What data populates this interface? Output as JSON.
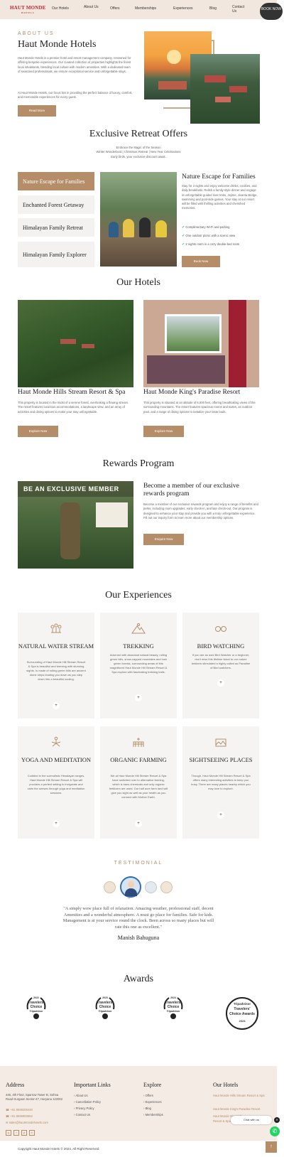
{
  "nav": {
    "logo": "HAUT MONDE",
    "logo_sub": "HOTELS",
    "links": [
      "Our Hotels",
      "About Us",
      "Offers",
      "Memberships",
      "Experiences",
      "Blog",
      "Contact Us"
    ],
    "book": "BOOK NOW"
  },
  "about": {
    "eyebrow": "ABOUT US",
    "title": "Haut Monde Hotels",
    "p1": "Haut Monde Hotels is a premier hotel and resort management company, renowned for offering bespoke experiences. Our curated collection of properties highlights the finest local inhabitants, blending local culture with modern amenities. With a dedicated team of seasoned professionals, we ensure exceptional service and unforgettable stays.",
    "p2": "At Haut Monde Hotels, our focus lies in providing the perfect balance of luxury, comfort, and memorable experiences for every guest.",
    "button": "Read More"
  },
  "offers": {
    "title": "Exclusive Retreat Offers",
    "sub1": "Embrace the Magic of the Season",
    "sub2": "Winter Wonderland | Christmas Retreat | New Year Celebrations",
    "sub3": "Early birds, your exclusive discount await.",
    "tabs": [
      "Nature Escape for Families",
      "Enchanted Forest Getaway",
      "Himalayan Family Retreat",
      "Himalayan Family Explorer"
    ],
    "detail_title": "Nature Escape for Families",
    "detail_text": "Stay for 3 nights and enjoy welcome drinks, cookies, and daily breakfasts. Relish a family-style dinner and engage in unforgettable guided river treks, Jejime, Jivanta Bridge, swimming and pool-side games. Your stay at our resort will be filled with thrilling activities and cherished memories.",
    "features": [
      "Complimentary Wi-Fi and parking",
      "One outdoor picnic with a scenic view",
      "2 nights room in a cozy double-bed room"
    ],
    "button": "Book Now"
  },
  "hotels": {
    "title": "Our Hotels",
    "items": [
      {
        "name": "Haut Monde Hills Stream Resort & Spa",
        "desc": "This property is located in the midst of a serene forest, overlooking a flowing stream. The resort features luxurious accommodations, a landscape view, and an array of activities and dining options to make your stay unforgettable.",
        "button": "Explore Now"
      },
      {
        "name": "Haut Monde King's Paradise Resort",
        "desc": "This property is situated at an altitude of 6,000 feet, offering breathtaking views of the surrounding mountains. The resort features spacious rooms and suites, an outdoor pool, and a range of dining options to tantalize your taste buds.",
        "button": "Explore Now"
      }
    ]
  },
  "rewards": {
    "title": "Rewards Program",
    "banner": "BE AN EXCLUSIVE MEMBER",
    "heading": "Become a member of our exclusive rewards program",
    "text": "Become a member of our exclusive rewards program and enjoy a range of benefits and perks, including room upgrades, early check-in, and late check-out. Our program is designed to enhance your stay and provide you with a truly unforgettable experience. Fill out our inquiry form to learn more about our membership options.",
    "button": "Enquire Now"
  },
  "experiences": {
    "title": "Our Experiences",
    "items": [
      {
        "title": "NATURAL WATER STREAM",
        "desc": "Surrounding of Haut Monde Hill Stream Resort & Spa is beautiful and teeming with stunning sights. Is made of rolling green hills are ancient stone steps leading you down as you step down into a beautiful cooling."
      },
      {
        "title": "TREKKING",
        "desc": "Adorned with abundant natural beauty, rolling green hills, snow-capped mountains and lush green forests, surrounding areas of this magnificent Haut Monde Hill Stream Resort & Spa explore with fascinating trekking trails."
      },
      {
        "title": "BIRD WATCHING",
        "desc": "If you are an avid Bird Watcher or a beginner, don't miss this lifetime ticket to our nature trekkers stimulated a highly called as Paradise of Bird watchers."
      },
      {
        "title": "YOGA AND MEDITATION",
        "desc": "Cuddled in the surrealistic Himalayan ranges, Haut Monde Hill Stream Resort & Spa will provides a perfect setting to invigorate and calm the senses through yoga and meditation sessions."
      },
      {
        "title": "ORGANIC FARMING",
        "desc": "We at Haut Monde Hill Stream Resort & Spa have switched over to alternative farming, which is sans chemicals and only organic fertilizers are used. Our half acre farm land will give you sight as well as your health as you connect with Mother Earth."
      },
      {
        "title": "SIGHTSEEING PLACES",
        "desc": "Though, Haut Monde Hill Stream Resort & Spa offers many interesting activities to keep you busy. There are many places nearby which you may love to explore."
      }
    ],
    "plus": "+"
  },
  "testimonial": {
    "eyebrow": "TESTIMONIAL",
    "quote": "\"A simply wow place full of relaxation. Amazing weather, professional staff, decent Amenities and a wonderful atmosphere. A must go place for families. Safe for kids. Management is at your service round the clock. Been across so many places but will rate this one as excellent.\"",
    "author": "Manish Bahuguna",
    "quote_mark": "“"
  },
  "awards": {
    "title": "Awards",
    "badges": [
      {
        "line1": "2022",
        "line2": "Travelers'",
        "line3": "Choice",
        "line4": "Tripadvisor"
      },
      {
        "line1": "2023",
        "line2": "Travelers'",
        "line3": "Choice",
        "line4": "Tripadvisor"
      },
      {
        "line1": "2024",
        "line2": "Travelers'",
        "line3": "Choice",
        "line4": "Tripadvisor"
      },
      {
        "line1": "Tripadvisor",
        "line2": "Travelers'",
        "line3": "Choice Awards",
        "line4": "2024"
      }
    ]
  },
  "footer": {
    "address_title": "Address",
    "address": "446, 4th Floor, Sparrow Tower B, Sohna Road Gurgaon Sector-47, Haryana 122002",
    "phone1": "+91 9599200440",
    "phone2": "+91 8595893652",
    "email": "sales@hautmondehotels.com",
    "links_title": "Important Links",
    "links": [
      "About Us",
      "Cancellation Policy",
      "Privacy Policy",
      "Contact Us"
    ],
    "explore_title": "Explore",
    "explore": [
      "Offers",
      "Experiences",
      "Blog",
      "Memberships"
    ],
    "hotels_title": "Our Hotels",
    "hotels": [
      "Haut Monde Hills Stream Resort & Spa",
      "Haut Monde King's Paradise Resort",
      "Haut Monde Riverside Resort & Spa Rishikesh"
    ],
    "copyright": "Copyright Haut Monde Hotels © 2024. All Right Reserved.",
    "chat": "Chat with us",
    "social": [
      "ig",
      "f",
      "yt",
      "in"
    ]
  },
  "colors": {
    "accent": "#b58d68",
    "nav_bg": "#f2e7df",
    "footer_bg": "#f3ebe4"
  }
}
